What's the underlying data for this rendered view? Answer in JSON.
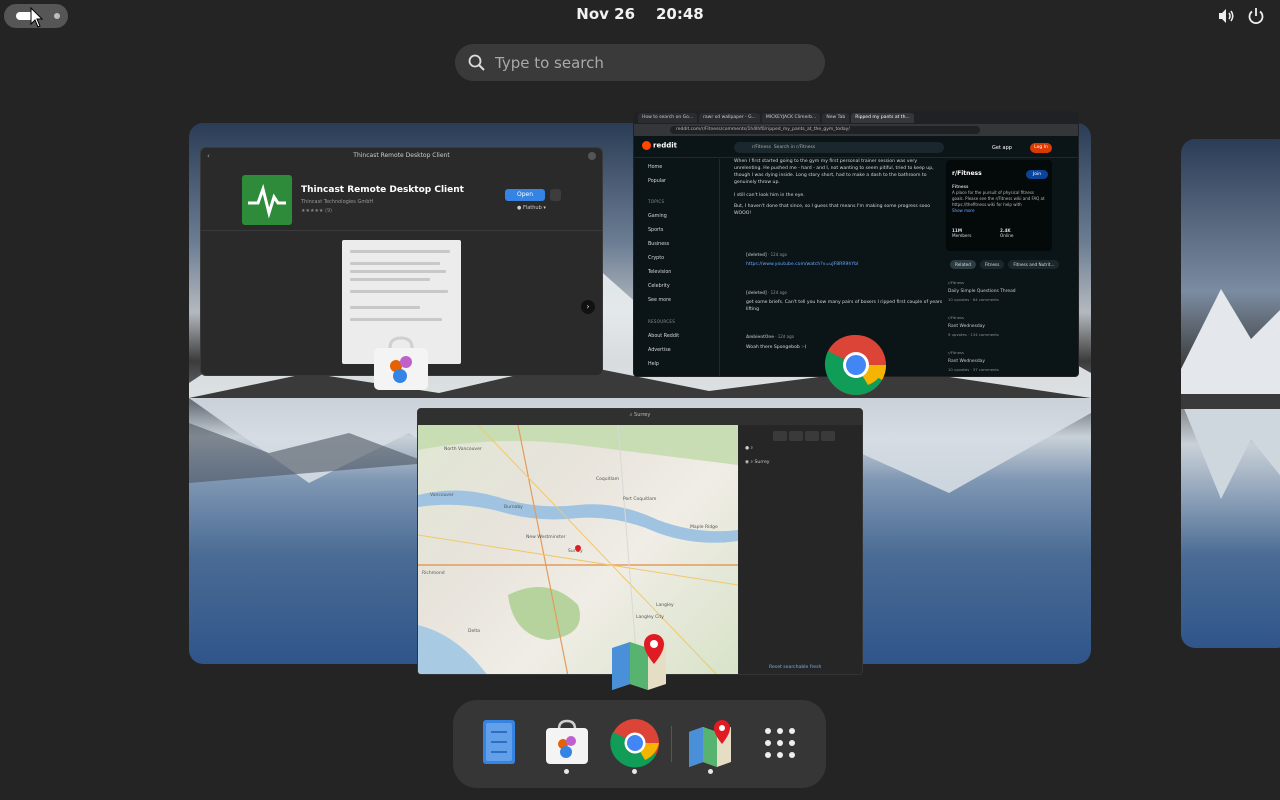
{
  "topbar": {
    "date": "Nov 26",
    "time": "20:48"
  },
  "search": {
    "placeholder": "Type to search"
  },
  "store_window": {
    "title": "Thincast Remote Desktop Client",
    "app_name": "Thincast Remote Desktop Client",
    "developer": "Thincast Technologies GmbH",
    "rating_count": "(9)",
    "open_label": "Open",
    "source_label": "Flathub"
  },
  "chrome_window": {
    "tabs": [
      "How to search on Go...",
      "rawr xd wallpaper - G...",
      "MICKEYJACK Climerb...",
      "New Tab",
      "Ripped my pants at th..."
    ],
    "url": "reddit.com/r/Fitness/comments/1h4lhf0/ripped_my_pants_at_the_gym_today/",
    "site": "reddit",
    "search_placeholder": "Search in r/Fitness",
    "subreddit_chip": "r/Fitness",
    "get_app": "Get app",
    "login": "Log In",
    "nav": [
      "Home",
      "Popular"
    ],
    "topics_header": "TOPICS",
    "topics": [
      "Gaming",
      "Sports",
      "Business",
      "Crypto",
      "Television",
      "Celebrity",
      "See more"
    ],
    "resources_header": "RESOURCES",
    "resources": [
      "About Reddit",
      "Advertise",
      "Help"
    ],
    "post_lines": [
      "When I first started going to the gym my first personal trainer session was very",
      "unrelenting. He pushed me - hard - and I, not wanting to seem pitiful, tried to keep up,",
      "though I was dying inside. Long story short, had to make a dash to the bathroom to",
      "genuinely throw up.",
      "I still can't look him in the eye.",
      "But, I haven't done that since, so I guess that means I'm making some progress sooo",
      "WOOO!"
    ],
    "comments": [
      {
        "user": "[deleted]",
        "age": "12d ago",
        "text": "https://www.youtube.com/watch?v=uJF8RR9hYbI",
        "is_link": true
      },
      {
        "user": "[deleted]",
        "age": "12d ago",
        "text": "get some briefs. Can't tell you how many pairs of boxers I ripped first couple of years lifting",
        "is_link": false
      },
      {
        "user": "AmbientOne",
        "age": "12d ago",
        "text": "Woah there Spongebob :-)",
        "is_link": false
      }
    ],
    "card": {
      "name": "r/Fitness",
      "join": "Join",
      "subtitle": "Fitness",
      "description": "A place for the pursuit of physical fitness goals. Please see the r/Fitness wiki and FAQ at https://thefitness.wiki for help with",
      "show_more": "Show more",
      "members_value": "11M",
      "members_label": "Members",
      "online_value": "2.4K",
      "online_label": "Online"
    },
    "chips": [
      "Related",
      "Fitness",
      "Fitness and Nutrit..."
    ],
    "related": [
      {
        "sub": "r/Fitness",
        "title": "Daily Simple Questions Thread",
        "meta": "10 upvotes · 64 comments"
      },
      {
        "sub": "r/Fitness",
        "title": "Rant Wednesday",
        "meta": "9 upvotes · 134 comments"
      },
      {
        "sub": "r/Fitness",
        "title": "Rant Wednesday",
        "meta": "10 upvotes · 37 comments"
      }
    ]
  },
  "maps_window": {
    "title": "Surrey",
    "search_value": "Surrey",
    "labels": [
      "North Vancouver",
      "Vancouver",
      "Burnaby",
      "Coquitlam",
      "Port Coquitlam",
      "Maple Ridge",
      "New Westminster",
      "Surrey",
      "Richmond",
      "Delta",
      "Langley",
      "Langley City"
    ],
    "footer": "Reset searchable fresh"
  },
  "dash": {
    "apps": [
      {
        "name": "Text Editor",
        "running": false
      },
      {
        "name": "Software",
        "running": true
      },
      {
        "name": "Google Chrome",
        "running": true
      },
      {
        "name": "Maps",
        "running": true
      },
      {
        "name": "Show Apps",
        "running": false
      }
    ]
  }
}
